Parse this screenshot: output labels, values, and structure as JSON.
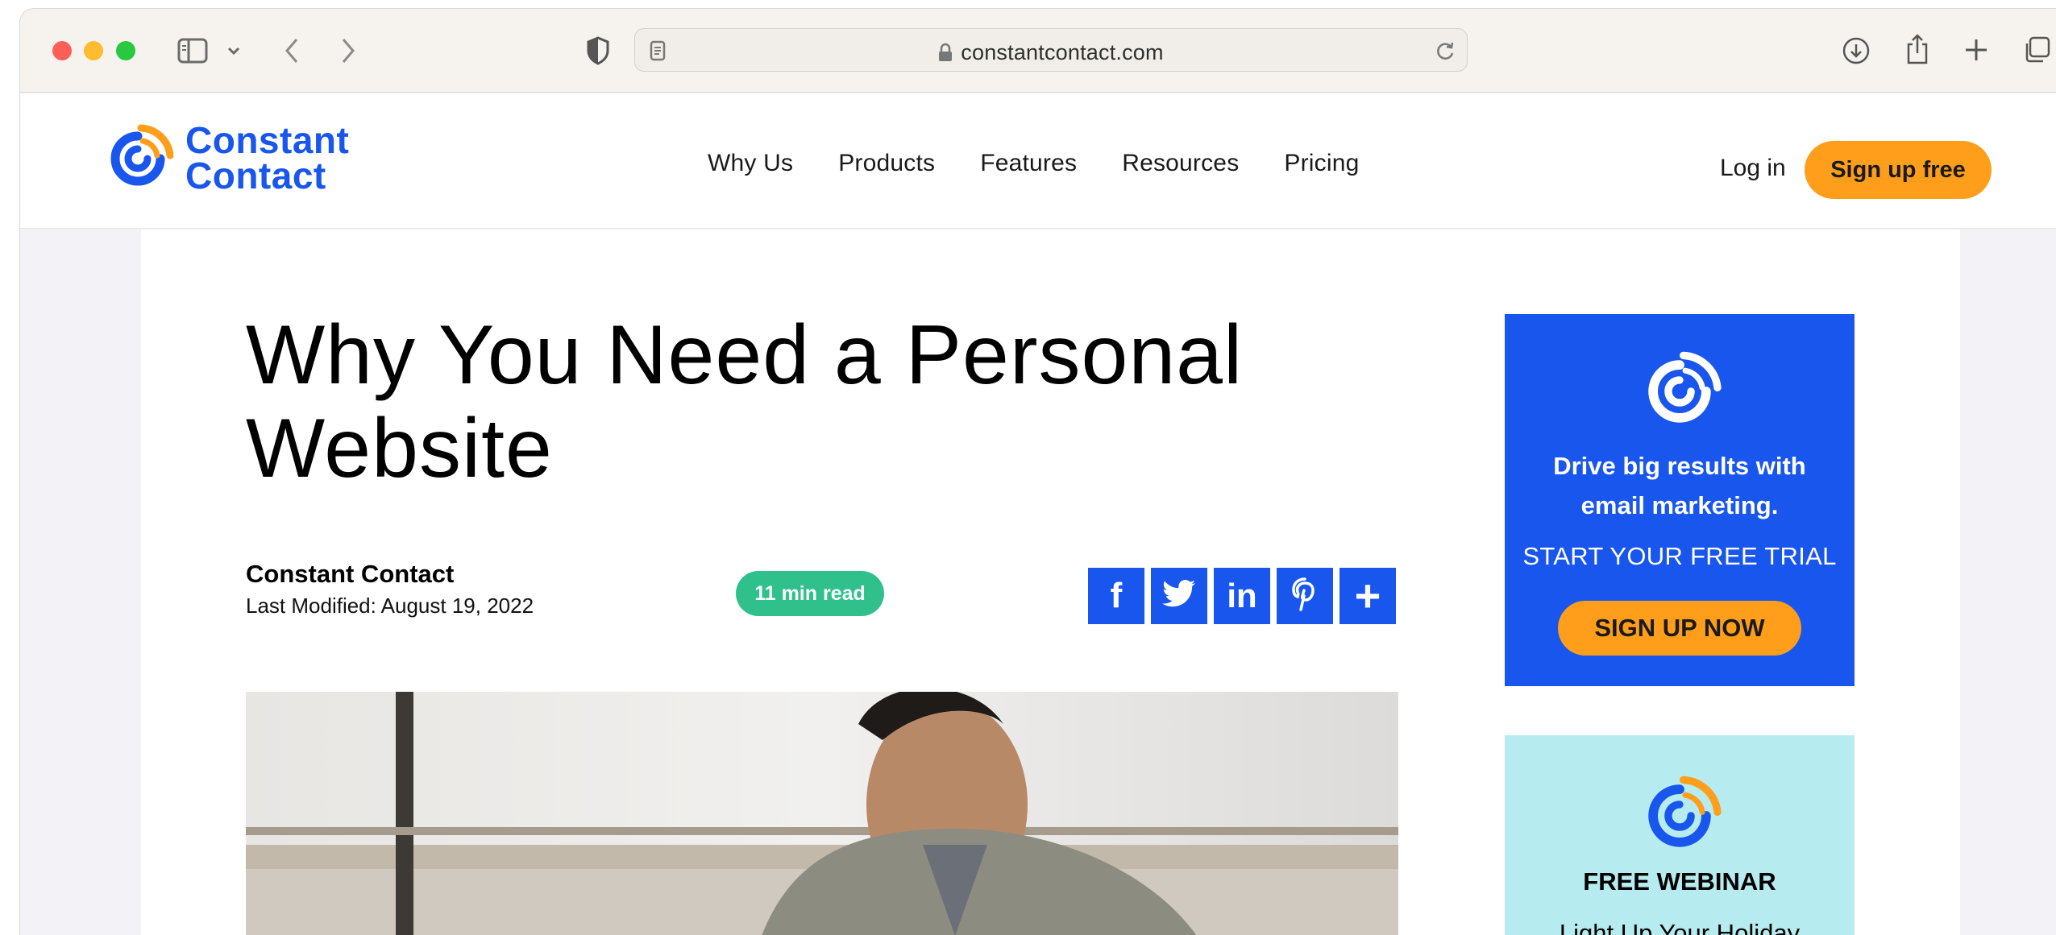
{
  "browser": {
    "url": "constantcontact.com",
    "icons": [
      "sidebar-icon",
      "chevron-down-icon",
      "back-icon",
      "forward-icon",
      "privacy-shield-icon",
      "reader-icon",
      "lock-icon",
      "reload-icon",
      "download-icon",
      "share-icon",
      "new-tab-icon",
      "tab-overview-icon"
    ]
  },
  "header": {
    "logo": {
      "line1": "Constant",
      "line2": "Contact"
    },
    "nav": [
      "Why Us",
      "Products",
      "Features",
      "Resources",
      "Pricing"
    ],
    "login": "Log in",
    "signup": "Sign up free"
  },
  "article": {
    "title": "Why You Need a Personal Website",
    "author": "Constant Contact",
    "modified": "Last Modified: August 19, 2022",
    "read_time": "11 min read",
    "share": [
      "f",
      "twitter",
      "in",
      "pinterest",
      "+"
    ]
  },
  "sidebar": {
    "ad1": {
      "headline": "Drive big results with email marketing.",
      "subhead": "START YOUR FREE TRIAL",
      "button": "SIGN UP NOW"
    },
    "ad2": {
      "headline": "FREE WEBINAR",
      "subhead": "Light Up Your Holiday"
    }
  },
  "colors": {
    "brand_blue": "#1856ed",
    "accent_orange": "#ff9e1b",
    "badge_green": "#2fc08c",
    "ad_cyan": "#b6ecf0"
  }
}
